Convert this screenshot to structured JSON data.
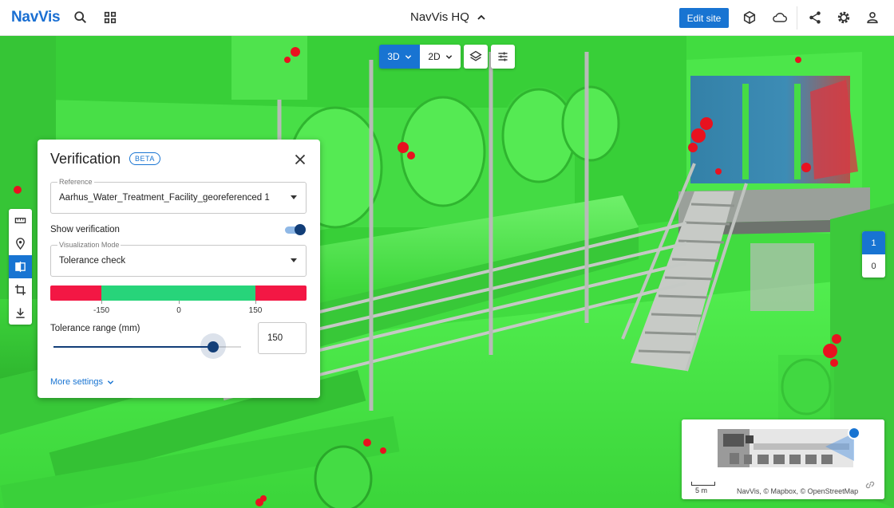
{
  "app": {
    "logo": "NavVis",
    "site_title": "NavVis HQ"
  },
  "header": {
    "edit_site_label": "Edit site",
    "icons": [
      "search-icon",
      "apps-grid-icon",
      "chevron-up-icon",
      "cube-icon",
      "cloud-icon",
      "share-icon",
      "gear-icon",
      "user-icon"
    ]
  },
  "view_controls": {
    "mode_3d": "3D",
    "mode_2d": "2D",
    "active_mode": "3D",
    "icons": [
      "layers-icon",
      "sliders-icon"
    ]
  },
  "left_toolbar": {
    "items": [
      "ruler-icon",
      "location-pin-icon",
      "verification-icon",
      "crop-icon",
      "download-icon"
    ],
    "active": "verification-icon"
  },
  "floors": {
    "items": [
      "1",
      "0"
    ],
    "active": "1"
  },
  "verification_panel": {
    "title": "Verification",
    "badge": "BETA",
    "reference": {
      "label": "Reference",
      "value": "Aarhus_Water_Treatment_Facility_georeferenced 1"
    },
    "show_verification": {
      "label": "Show verification",
      "enabled": true
    },
    "visualization_mode": {
      "label": "Visualization Mode",
      "value": "Tolerance check"
    },
    "tolerance_scale": {
      "ticks": [
        "-150",
        "0",
        "150"
      ],
      "colors": {
        "out_of_tolerance": "#f31744",
        "in_tolerance": "#27d47a"
      }
    },
    "tolerance_range": {
      "label": "Tolerance range (mm)",
      "value": "150",
      "slider_fraction": 0.85
    },
    "more_settings": "More settings"
  },
  "minimap": {
    "scale_label": "5 m",
    "attribution": "NavVis, © Mapbox, © OpenStreetMap"
  },
  "colors": {
    "accent": "#1874d2",
    "dark_accent": "#123e78",
    "pointcloud_green": "#45e245",
    "deviation_red": "#e8121f"
  }
}
